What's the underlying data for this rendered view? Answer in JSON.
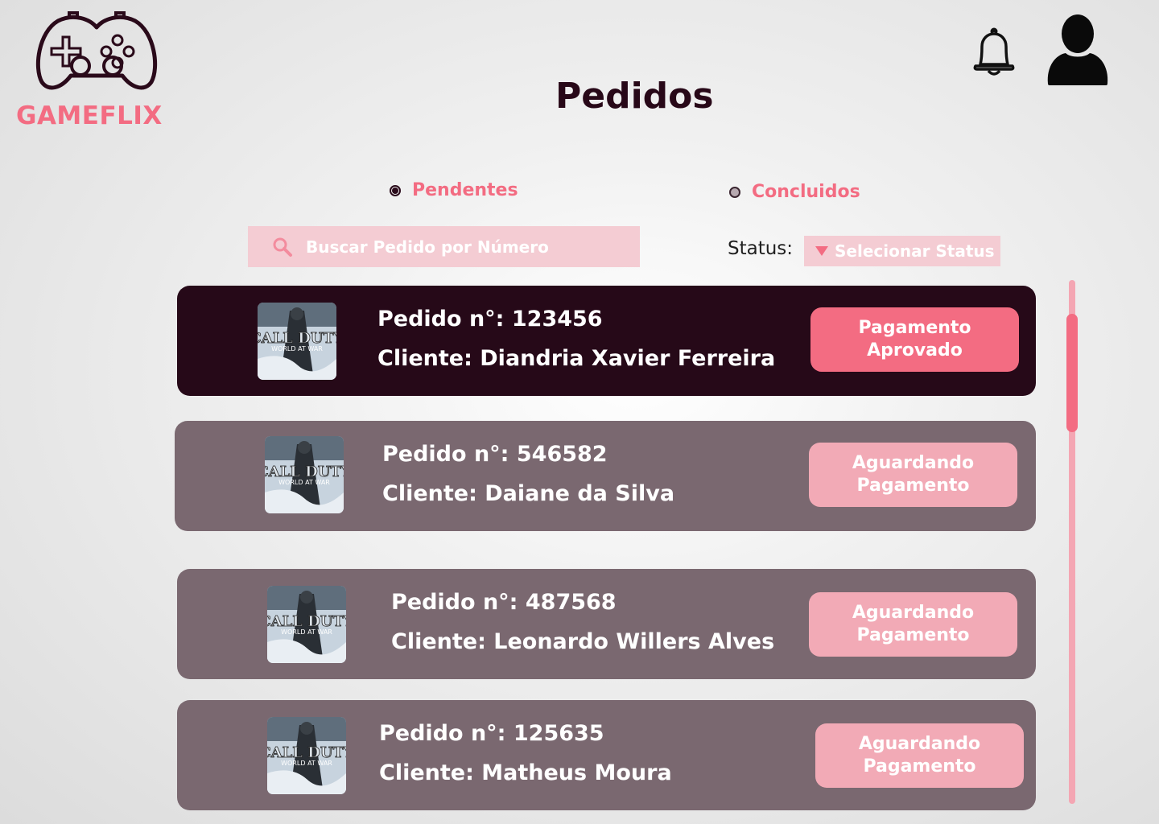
{
  "app": {
    "brand": "GAMEFLIX"
  },
  "header": {
    "title": "Pedidos"
  },
  "icons": {
    "logo": "gamepad-icon",
    "notifications": "bell-icon",
    "profile": "user-icon",
    "search": "search-icon",
    "dropdown": "caret-down-icon"
  },
  "colors": {
    "accent": "#f36c82",
    "dark": "#260918",
    "card": "#7a6870",
    "soft": "#f4ccd3"
  },
  "filters": {
    "options": [
      {
        "label": "Pendentes",
        "selected": true
      },
      {
        "label": "Concluidos",
        "selected": false
      }
    ]
  },
  "search": {
    "placeholder": "Buscar Pedido por Número",
    "value": ""
  },
  "status_filter": {
    "label": "Status:",
    "placeholder": "Selecionar Status"
  },
  "orders": [
    {
      "number": "Pedido n°: 123456",
      "client": "Cliente: Diandria Xavier Ferreira",
      "status": [
        "Pagamento",
        "Aprovado"
      ],
      "game": "CALL OF DUTY WORLD AT WAR",
      "highlighted": true
    },
    {
      "number": "Pedido n°: 546582",
      "client": "Cliente: Daiane da Silva",
      "status": [
        "Aguardando",
        "Pagamento"
      ],
      "game": "CALL OF DUTY WORLD AT WAR",
      "highlighted": false
    },
    {
      "number": "Pedido n°: 487568",
      "client": "Cliente: Leonardo Willers Alves",
      "status": [
        "Aguardando",
        "Pagamento"
      ],
      "game": "CALL OF DUTY WORLD AT WAR",
      "highlighted": false
    },
    {
      "number": "Pedido n°: 125635",
      "client": "Cliente: Matheus Moura",
      "status": [
        "Aguardando",
        "Pagamento"
      ],
      "game": "CALL OF DUTY WORLD AT WAR",
      "highlighted": false
    }
  ]
}
